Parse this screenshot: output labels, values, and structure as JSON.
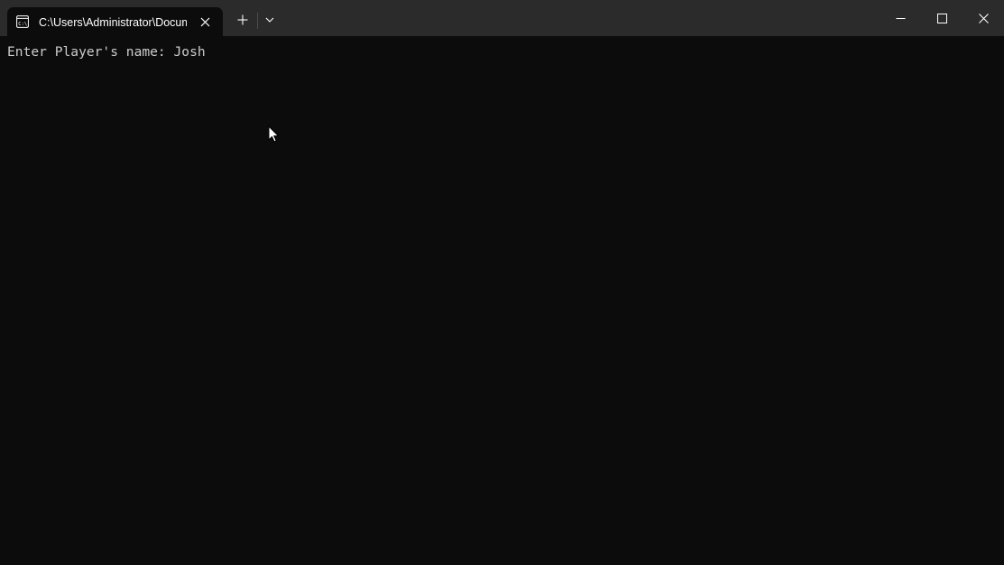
{
  "window": {
    "tab_title": "C:\\Users\\Administrator\\Documents",
    "tab_icon": "console-icon",
    "new_tab_icon": "plus-icon",
    "dropdown_icon": "chevron-down-icon",
    "controls": [
      "minimize-icon",
      "maximize-icon",
      "close-icon"
    ]
  },
  "terminal": {
    "prompt": "Enter Player's name: ",
    "input": "Josh"
  },
  "colors": {
    "titlebar": "#2b2b2b",
    "background": "#0c0c0c",
    "text": "#cccccc"
  }
}
